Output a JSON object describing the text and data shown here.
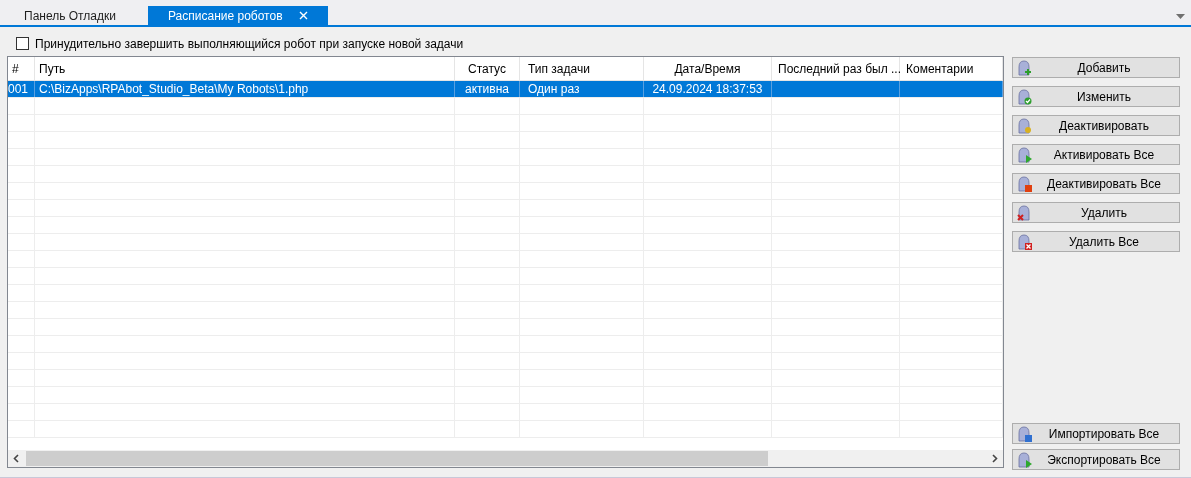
{
  "tabs": [
    {
      "label": "Панель Отладки",
      "selected": false
    },
    {
      "label": "Расписание роботов",
      "selected": true
    }
  ],
  "force_stop": {
    "label": "Принудительно завершить выполняющийся робот при запуске новой задачи",
    "checked": false
  },
  "table": {
    "columns": [
      "#",
      "Путь",
      "Статус",
      "Тип задачи",
      "Дата/Время",
      "Последний раз был ...",
      "Коментарии"
    ],
    "rows": [
      {
        "selected": true,
        "cells": [
          "001",
          "C:\\BizApps\\RPAbot_Studio_Beta\\My Robots\\1.php",
          "активна",
          "Один раз",
          "24.09.2024 18:37:53",
          "",
          ""
        ]
      }
    ]
  },
  "buttons": [
    "Добавить",
    "Изменить",
    "Деактивировать",
    "Активировать Все",
    "Деактивировать Все",
    "Удалить",
    "Удалить Все"
  ],
  "bottom_buttons": [
    "Импортировать Все",
    "Экспортировать Все"
  ]
}
